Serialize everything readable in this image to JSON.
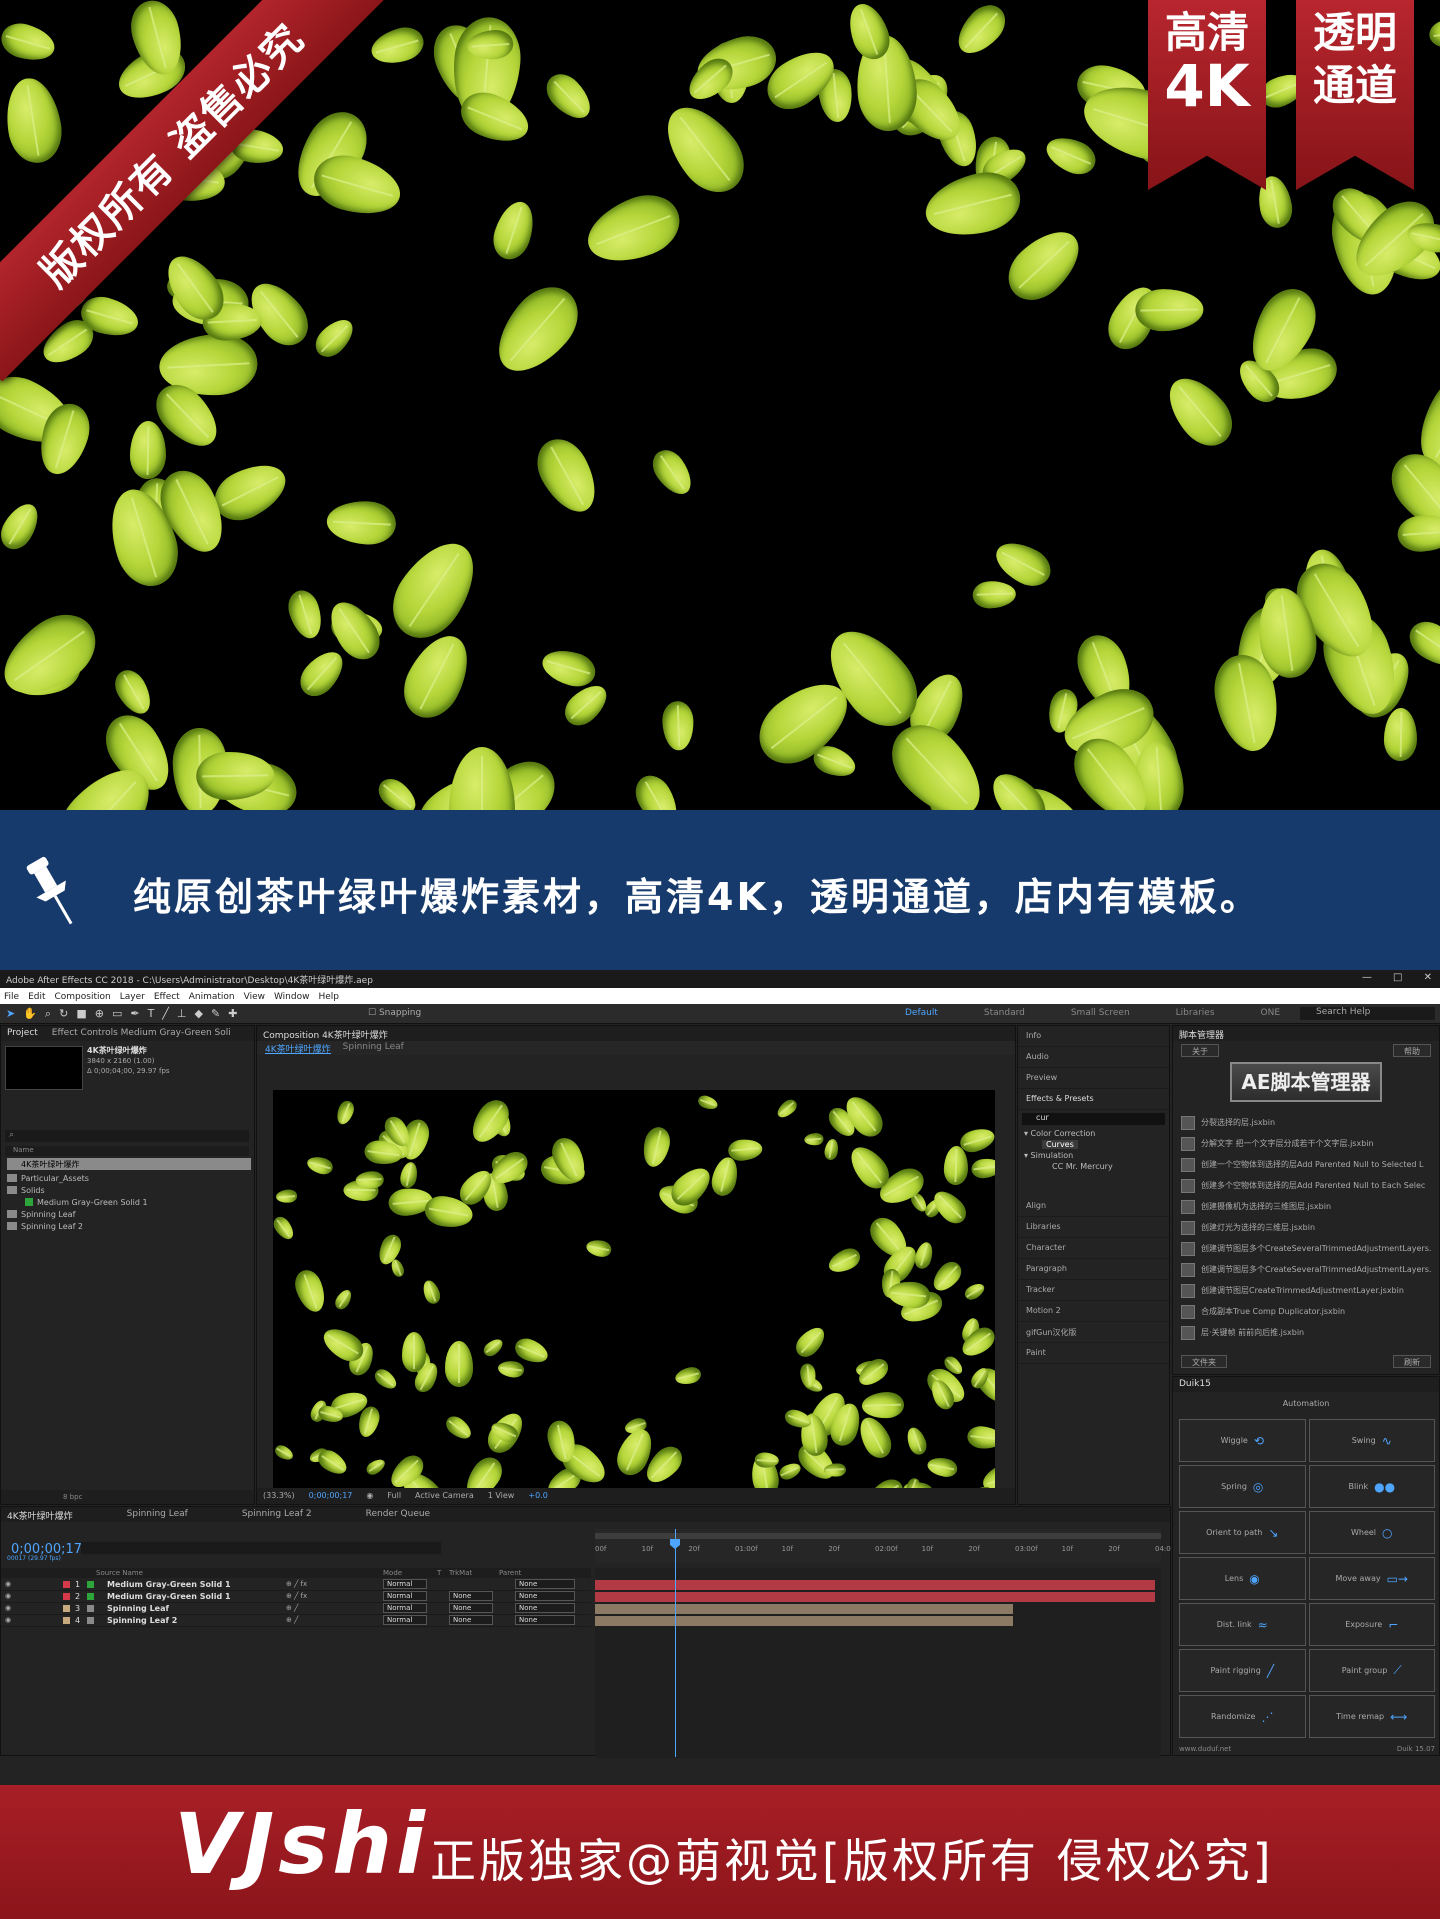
{
  "hero": {
    "ribbon_diag": "版权所有 盗售必究",
    "tag_left": {
      "line1": "高清",
      "line2": "4K"
    },
    "tag_right": {
      "line1": "透明",
      "line2": "通道"
    }
  },
  "banner": {
    "text": "纯原创茶叶绿叶爆炸素材，高清4K，透明通道，店内有模板。",
    "icon": "pushpin-icon"
  },
  "ae": {
    "title": "Adobe After Effects CC 2018 - C:\\Users\\Administrator\\Desktop\\4K茶叶绿叶爆炸.aep",
    "window_controls": "— □ ✕",
    "menu": [
      "File",
      "Edit",
      "Composition",
      "Layer",
      "Effect",
      "Animation",
      "View",
      "Window",
      "Help"
    ],
    "snapping": "Snapping",
    "workspaces": [
      "Default",
      "Standard",
      "Small Screen",
      "Libraries",
      "ONE",
      "TWO"
    ],
    "search_help": "Search Help",
    "project": {
      "tab": "Project",
      "tab2": "Effect Controls Medium Gray-Green Soli",
      "comp_name": "4K茶叶绿叶爆炸",
      "comp_info1": "3840 x 2160 (1.00)",
      "comp_info2": "Δ 0;00;04;00, 29.97 fps",
      "col_name": "Name",
      "items": [
        {
          "label": "4K茶叶绿叶爆炸",
          "selected": true
        },
        {
          "label": "Particular_Assets"
        },
        {
          "label": "Solids"
        },
        {
          "label": "Medium Gray-Green Solid 1"
        },
        {
          "label": "Spinning Leaf"
        },
        {
          "label": "Spinning Leaf 2"
        }
      ],
      "bpc": "8 bpc"
    },
    "composition": {
      "tab": "Composition 4K茶叶绿叶爆炸",
      "sub_tabs": [
        "4K茶叶绿叶爆炸",
        "Spinning Leaf"
      ],
      "zoom": "(33.3%)",
      "timecode": "0;00;00;17",
      "resolution": "Full",
      "camera": "Active Camera",
      "view": "1 View",
      "exposure": "+0.0"
    },
    "right_panel": {
      "items_top": [
        "Info",
        "Audio",
        "Preview"
      ],
      "effects_title": "Effects & Presets",
      "effects_search": "cur",
      "tree": [
        "▾ Color Correction",
        "Curves",
        "▾ Simulation",
        "CC Mr. Mercury"
      ],
      "items_bottom": [
        "Align",
        "Libraries",
        "Character",
        "Paragraph",
        "Tracker",
        "Motion 2",
        "gifGun汉化版",
        "Paint"
      ]
    },
    "script_manager": {
      "title": "脚本管理器",
      "about": "关于",
      "help": "帮助",
      "logo": "AE脚本管理器",
      "scripts": [
        "分裂选择的层.jsxbin",
        "分解文字 把一个文字层分成若干个文字层.jsxbin",
        "创建一个空物体到选择的层Add Parented Null to Selected L",
        "创建多个空物体到选择的层Add Parented Null to Each Selec",
        "创建摄像机为选择的三维图层.jsxbin",
        "创建灯光为选择的三维层.jsxbin",
        "创建调节图层多个CreateSeveralTrimmedAdjustmentLayers.js",
        "创建调节图层多个CreateSeveralTrimmedAdjustmentLayers.js",
        "创建调节图层CreateTrimmedAdjustmentLayer.jsxbin",
        "合成副本True Comp Duplicator.jsxbin",
        "层·关键帧 前前向后推.jsxbin"
      ],
      "folder": "文件夹",
      "refresh": "刷新"
    },
    "duik": {
      "title": "Duik15",
      "automation": "Automation",
      "buttons": [
        "Wiggle",
        "Swing",
        "Spring",
        "Blink",
        "Orient to path",
        "Wheel",
        "Lens",
        "Move away",
        "Dist. link",
        "Exposure",
        "Paint rigging",
        "Paint group",
        "Randomize",
        "Time remap"
      ],
      "footer_left": "www.duduf.net",
      "footer_right": "Duik 15.07"
    },
    "timeline": {
      "tabs": [
        "4K茶叶绿叶爆炸",
        "Spinning Leaf",
        "Spinning Leaf 2",
        "Render Queue"
      ],
      "current_time": "0;00;00;17",
      "fps": "00017 (29.97 fps)",
      "col_source": "Source Name",
      "col_mode": "Mode",
      "col_t": "T",
      "col_trkmat": "TrkMat",
      "col_parent": "Parent",
      "layers": [
        {
          "num": "1",
          "name": "Medium Gray-Green Solid 1",
          "mode": "Normal",
          "trkmat": "",
          "parent": "None",
          "label_color": "#d6394a"
        },
        {
          "num": "2",
          "name": "Medium Gray-Green Solid 1",
          "mode": "Normal",
          "trkmat": "None",
          "parent": "None",
          "label_color": "#d6394a"
        },
        {
          "num": "3",
          "name": "Spinning Leaf",
          "mode": "Normal",
          "trkmat": "None",
          "parent": "None",
          "label_color": "#c7a97d"
        },
        {
          "num": "4",
          "name": "Spinning Leaf 2",
          "mode": "Normal",
          "trkmat": "None",
          "parent": "None",
          "label_color": "#c7a97d"
        }
      ],
      "ruler_ticks": [
        "00f",
        "10f",
        "20f",
        "01:00f",
        "10f",
        "20f",
        "02:00f",
        "10f",
        "20f",
        "03:00f",
        "10f",
        "20f",
        "04:0"
      ]
    }
  },
  "footer": {
    "brand": "VJshi",
    "text": "正版独家@萌视觉[版权所有 侵权必究]"
  },
  "colors": {
    "ribbon_red": "#a81f26",
    "banner_blue": "#163a6b",
    "ae_blue": "#4ea5ff",
    "leaf_green": "#b5d63a"
  }
}
